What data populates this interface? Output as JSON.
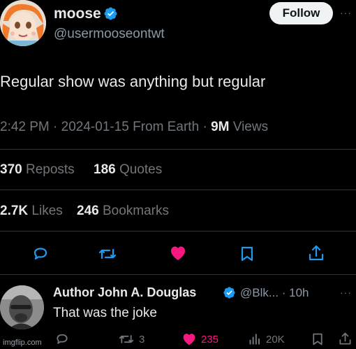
{
  "tweet": {
    "author_name": "moose",
    "author_handle": "@usermooseontwt",
    "follow_label": "Follow",
    "more_label": "···",
    "text": "Regular show was anything but regular",
    "time": "2:42 PM",
    "sep1": " · ",
    "date": "2024-01-15",
    "location": " From Earth",
    "sep2": " · ",
    "views_count": "9M",
    "views_label": " Views",
    "reposts_count": "370",
    "reposts_label": " Reposts",
    "quotes_count": "186",
    "quotes_label": " Quotes",
    "likes_count": "2.7K",
    "likes_label": " Likes",
    "bookmarks_count": "246",
    "bookmarks_label": " Bookmarks"
  },
  "reply": {
    "author_name": "Author John A. Douglas",
    "author_handle": "@Blk... · 10h",
    "more_label": "···",
    "text": "That was the joke",
    "repost_count": "3",
    "like_count": "235",
    "views_count": "20K"
  },
  "watermark": "imgflip.com",
  "colors": {
    "verified": "#1d9bf0",
    "like": "#f91880",
    "action_icon": "#1d9bf0",
    "muted": "#71767b"
  }
}
